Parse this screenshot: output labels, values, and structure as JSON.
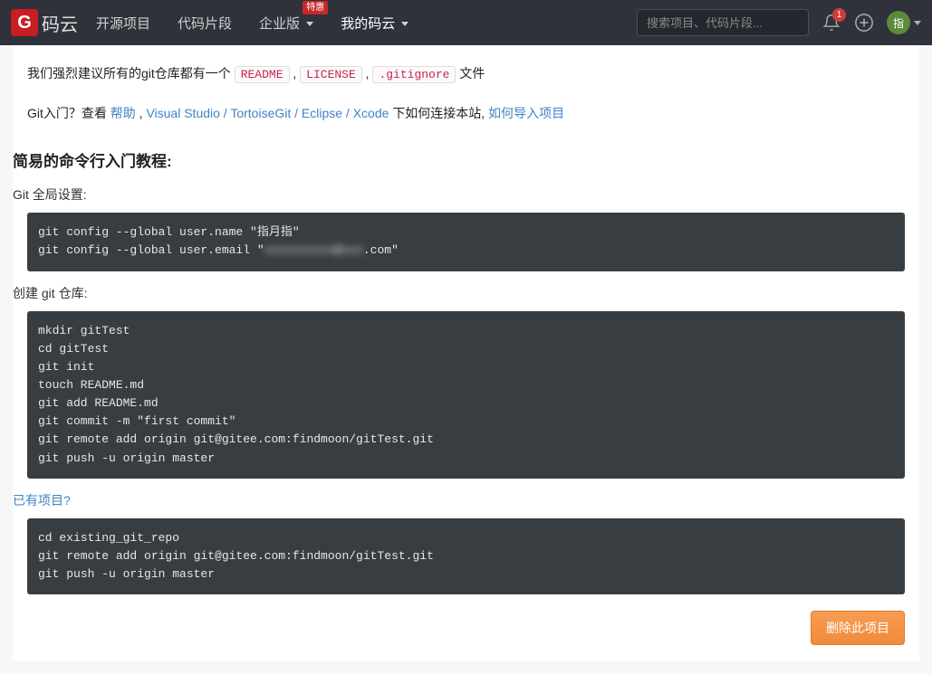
{
  "nav": {
    "logo_text": "码云",
    "links": {
      "projects": "开源项目",
      "snippets": "代码片段",
      "enterprise": "企业版",
      "enterprise_badge": "特惠",
      "mine": "我的码云"
    },
    "search_placeholder": "搜索项目、代码片段...",
    "notif_count": "1",
    "avatar_text": "指"
  },
  "intro": {
    "line1_a": "我们强烈建议所有的git仓库都有一个 ",
    "tag_readme": "README",
    "sep1": ", ",
    "tag_license": "LICENSE",
    "sep2": ", ",
    "tag_gitignore": ".gitignore",
    "line1_b": " 文件",
    "line2_a": "Git入门？查看 ",
    "help": "帮助",
    "sep3": " , ",
    "ides": "Visual Studio / TortoiseGit / Eclipse / Xcode",
    "line2_b": " 下如何连接本站, ",
    "import": "如何导入项目"
  },
  "sections": {
    "tutorial_title": "简易的命令行入门教程:",
    "global_title": "Git 全局设置:",
    "create_title": "创建 git 仓库:",
    "existing_title": "已有项目?"
  },
  "code": {
    "global_a": "git config --global user.name \"指月指\"\ngit config --global user.email \"",
    "global_blur": "xxxxxxxxxx@xxx",
    "global_b": ".com\"",
    "create": "mkdir gitTest\ncd gitTest\ngit init\ntouch README.md\ngit add README.md\ngit commit -m \"first commit\"\ngit remote add origin git@gitee.com:findmoon/gitTest.git\ngit push -u origin master",
    "existing": "cd existing_git_repo\ngit remote add origin git@gitee.com:findmoon/gitTest.git\ngit push -u origin master"
  },
  "buttons": {
    "delete": "删除此项目"
  }
}
